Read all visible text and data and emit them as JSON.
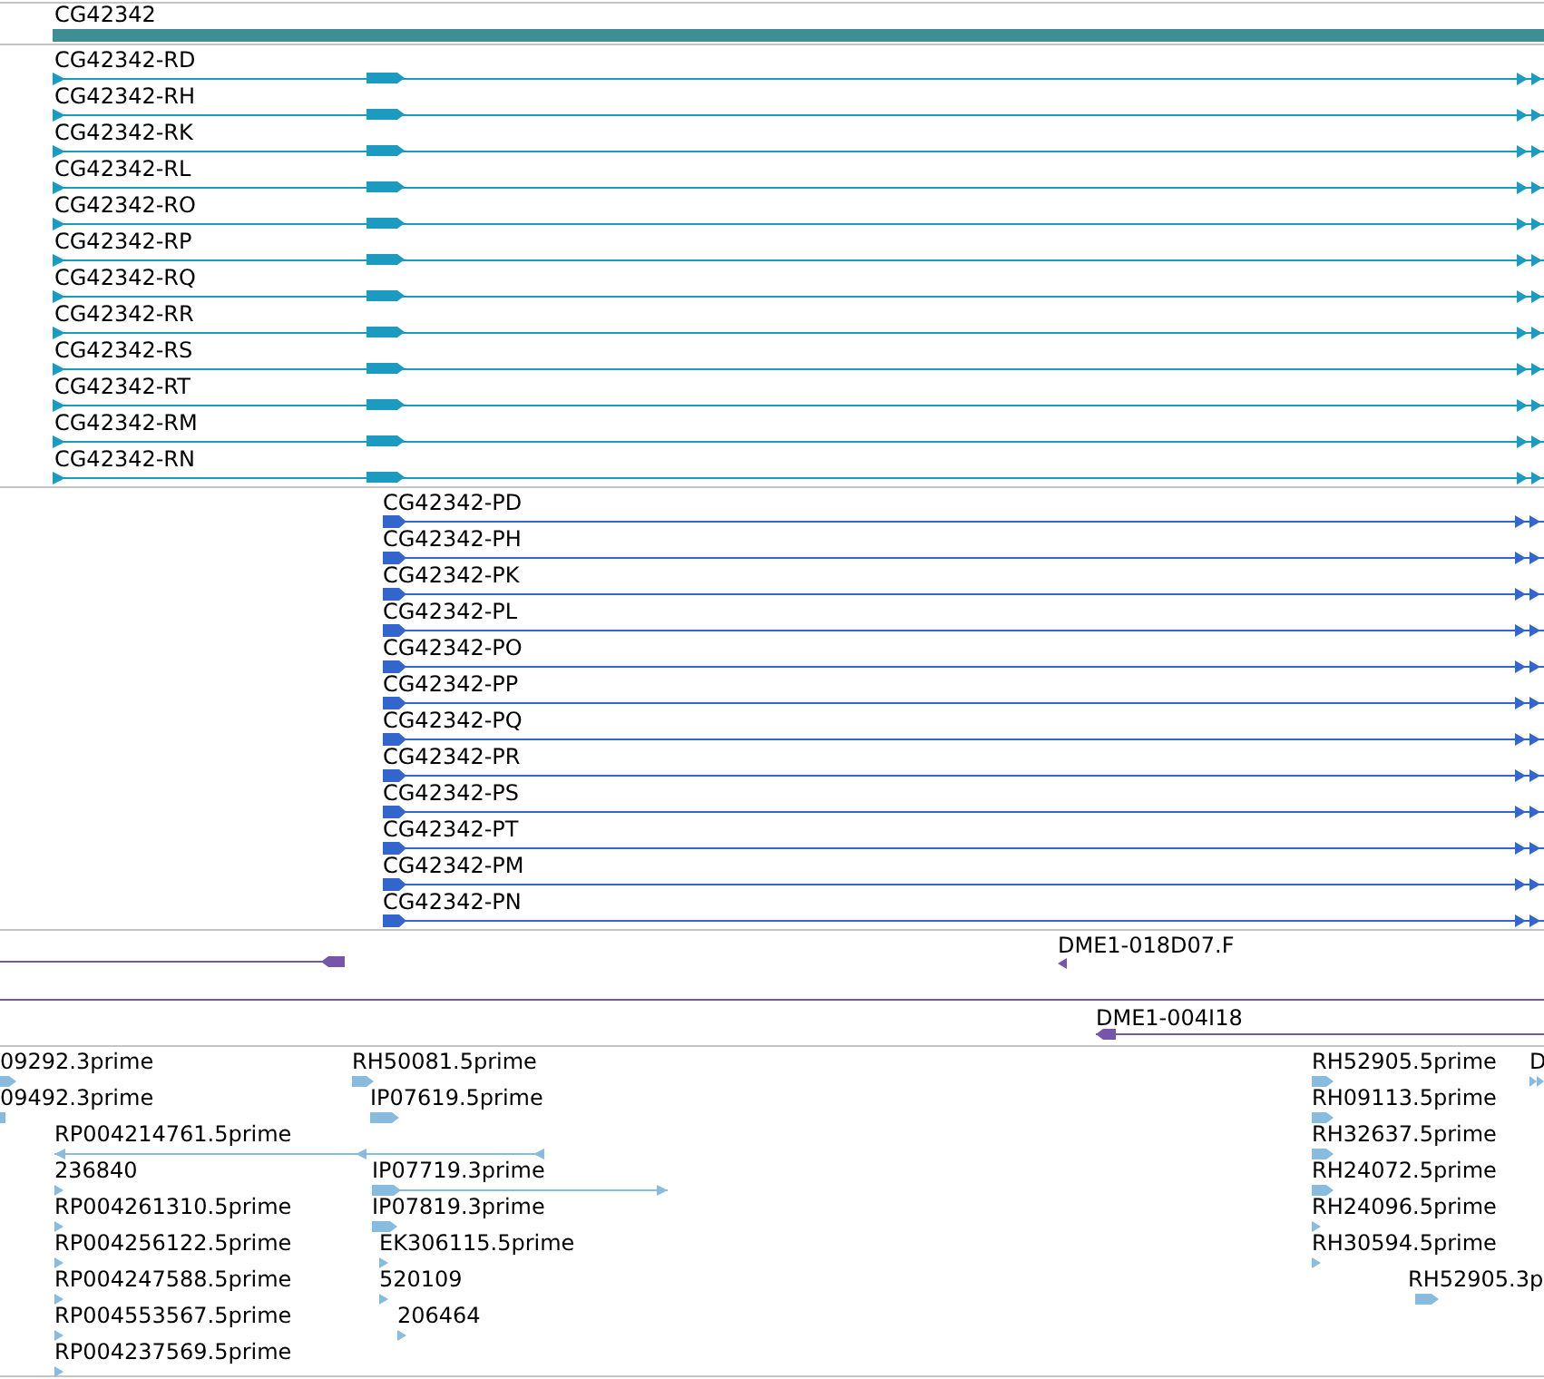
{
  "gene_track": {
    "gene": {
      "label": "CG42342"
    }
  },
  "transcript_track": {
    "transcripts": [
      {
        "label": "CG42342-RD"
      },
      {
        "label": "CG42342-RH"
      },
      {
        "label": "CG42342-RK"
      },
      {
        "label": "CG42342-RL"
      },
      {
        "label": "CG42342-RO"
      },
      {
        "label": "CG42342-RP"
      },
      {
        "label": "CG42342-RQ"
      },
      {
        "label": "CG42342-RR"
      },
      {
        "label": "CG42342-RS"
      },
      {
        "label": "CG42342-RT"
      },
      {
        "label": "CG42342-RM"
      },
      {
        "label": "CG42342-RN"
      }
    ]
  },
  "protein_track": {
    "proteins": [
      {
        "label": "CG42342-PD"
      },
      {
        "label": "CG42342-PH"
      },
      {
        "label": "CG42342-PK"
      },
      {
        "label": "CG42342-PL"
      },
      {
        "label": "CG42342-PO"
      },
      {
        "label": "CG42342-PP"
      },
      {
        "label": "CG42342-PQ"
      },
      {
        "label": "CG42342-PR"
      },
      {
        "label": "CG42342-PS"
      },
      {
        "label": "CG42342-PT"
      },
      {
        "label": "CG42342-PM"
      },
      {
        "label": "CG42342-PN"
      }
    ]
  },
  "clone_track": {
    "features": [
      {
        "label": "DME1-018D07.F",
        "reverse": true
      },
      {
        "label": "DME1-004I18",
        "reverse": true
      }
    ]
  },
  "est_track": {
    "features": [
      {
        "label": "09292.3prime",
        "reverse": false
      },
      {
        "label": "RH50081.5prime",
        "reverse": false
      },
      {
        "label": "RH52905.5prime",
        "reverse": false
      },
      {
        "label": "D",
        "reverse": false
      },
      {
        "label": "09492.3prime"
      },
      {
        "label": "IP07619.5prime",
        "reverse": false
      },
      {
        "label": "RH09113.5prime",
        "reverse": false
      },
      {
        "label": "RP004214761.5prime",
        "reverse": true
      },
      {
        "label": "RH32637.5prime",
        "reverse": false
      },
      {
        "label": "236840",
        "reverse": false
      },
      {
        "label": "IP07719.3prime",
        "reverse": false
      },
      {
        "label": "RH24072.5prime",
        "reverse": false
      },
      {
        "label": "RP004261310.5prime",
        "reverse": false
      },
      {
        "label": "IP07819.3prime",
        "reverse": false
      },
      {
        "label": "RH24096.5prime",
        "reverse": false
      },
      {
        "label": "RP004256122.5prime",
        "reverse": false
      },
      {
        "label": "EK306115.5prime",
        "reverse": false
      },
      {
        "label": "RH30594.5prime",
        "reverse": false
      },
      {
        "label": "RP004247588.5prime",
        "reverse": false
      },
      {
        "label": "520109",
        "reverse": false
      },
      {
        "label": "RH52905.3p",
        "reverse": false
      },
      {
        "label": "RP004553567.5prime",
        "reverse": false
      },
      {
        "label": "206464",
        "reverse": false
      },
      {
        "label": "RP004237569.5prime",
        "reverse": false
      }
    ]
  }
}
